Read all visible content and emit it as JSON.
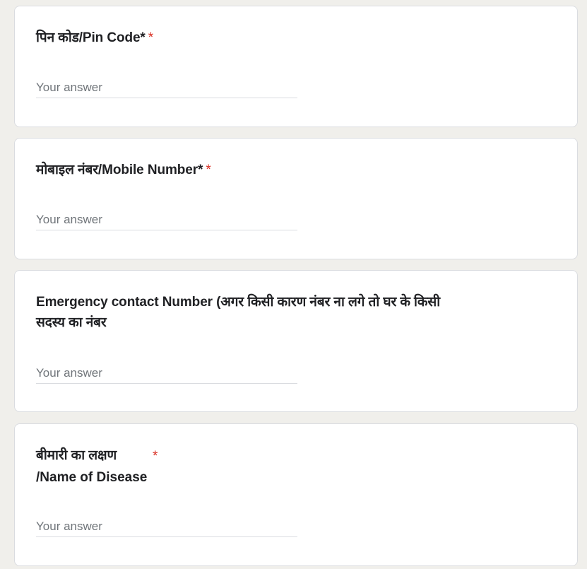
{
  "questions": [
    {
      "title": "पिन कोड/Pin Code*",
      "required_mark": "*",
      "placeholder": "Your answer",
      "value": ""
    },
    {
      "title": "मोबाइल नंबर/Mobile Number*",
      "required_mark": "*",
      "placeholder": "Your answer",
      "value": ""
    },
    {
      "title": "Emergency contact Number (अगर किसी कारण नंबर ना लगे तो घर के किसी सदस्य का नंबर",
      "placeholder": "Your answer",
      "value": ""
    },
    {
      "title": "बीमारी का लक्षण",
      "title_line2": "/Name of Disease",
      "required_mark": "*",
      "placeholder": "Your answer",
      "value": ""
    }
  ],
  "colors": {
    "background": "#f0efeb",
    "card": "#ffffff",
    "required": "#d93025",
    "placeholder": "#70757a"
  }
}
